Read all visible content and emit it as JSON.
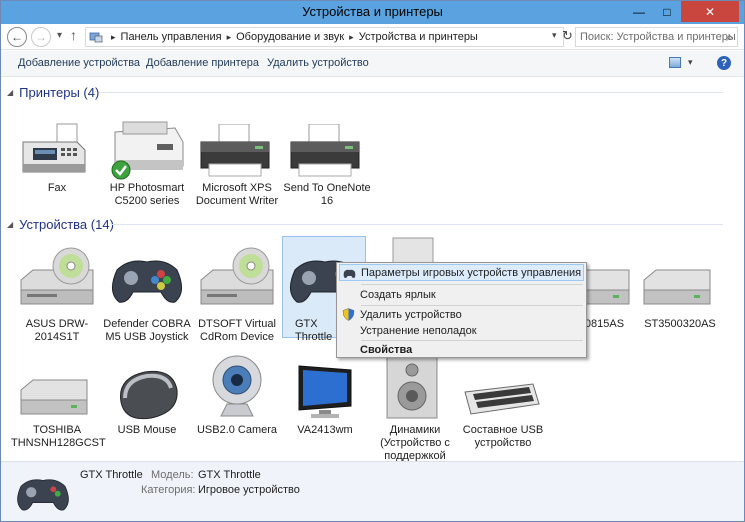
{
  "window": {
    "title": "Устройства и принтеры"
  },
  "address": {
    "breadcrumbs": [
      "Панель управления",
      "Оборудование и звук",
      "Устройства и принтеры"
    ],
    "search_placeholder": "Поиск: Устройства и принтеры"
  },
  "toolbar": {
    "add_device": "Добавление устройства",
    "add_printer": "Добавление принтера",
    "remove_device": "Удалить устройство",
    "help": "?"
  },
  "groups": {
    "printers": {
      "label": "Принтеры (4)"
    },
    "devices": {
      "label": "Устройства (14)"
    }
  },
  "printers": [
    {
      "name": "Fax",
      "icon": "fax-icon"
    },
    {
      "name": "HP Photosmart C5200 series",
      "icon": "printer-icon",
      "default": true
    },
    {
      "name": "Microsoft XPS Document Writer",
      "icon": "printer-icon"
    },
    {
      "name": "Send To OneNote 16",
      "icon": "printer-icon"
    }
  ],
  "devices": [
    {
      "name": "ASUS DRW-2014S1T",
      "icon": "optical-drive-icon"
    },
    {
      "name": "Defender COBRA M5 USB Joystick",
      "icon": "gamepad-icon"
    },
    {
      "name": "DTSOFT Virtual CdRom Device",
      "icon": "optical-drive-icon"
    },
    {
      "name": "GTX Throttle",
      "icon": "gamepad-icon",
      "selected": true
    },
    {
      "name": "…0815AS",
      "icon": "hard-drive-icon"
    },
    {
      "name": "ST3500320AS",
      "icon": "hard-drive-icon"
    },
    {
      "name": "TOSHIBA THNSNH128GCST",
      "icon": "hard-drive-icon"
    },
    {
      "name": "USB Mouse",
      "icon": "mouse-icon"
    },
    {
      "name": "USB2.0 Camera",
      "icon": "webcam-icon"
    },
    {
      "name": "VA2413wm",
      "icon": "monitor-icon"
    },
    {
      "name": "Динамики (Устройство с поддержкой",
      "icon": "speaker-icon"
    },
    {
      "name": "Составное USB устройство",
      "icon": "keyboard-icon"
    }
  ],
  "context_menu": {
    "items": [
      {
        "label": "Параметры игровых устройств управления"
      },
      {
        "label": "Создать ярлык"
      },
      {
        "label": "Удалить устройство"
      },
      {
        "label": "Устранение неполадок"
      },
      {
        "label": "Свойства"
      }
    ]
  },
  "details": {
    "title": "GTX Throttle",
    "model_label": "Модель:",
    "model_value": "GTX Throttle",
    "category_label": "Категория:",
    "category_value": "Игровое устройство"
  }
}
